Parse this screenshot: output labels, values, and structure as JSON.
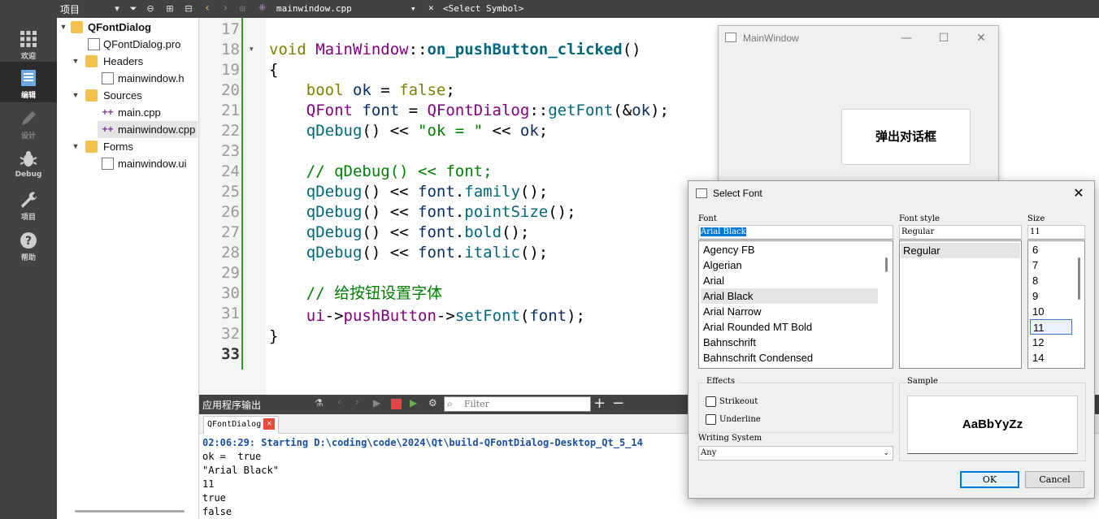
{
  "modebar": {
    "items": [
      {
        "label": "欢迎",
        "icon": "grid-icon"
      },
      {
        "label": "编辑",
        "icon": "document-icon"
      },
      {
        "label": "设计",
        "icon": "pencil-icon"
      },
      {
        "label": "Debug",
        "icon": "bug-icon"
      },
      {
        "label": "项目",
        "icon": "wrench-icon"
      },
      {
        "label": "帮助",
        "icon": "help-icon"
      }
    ]
  },
  "project": {
    "title": "项目",
    "tree": {
      "root": "QFontDialog",
      "pro": "QFontDialog.pro",
      "headers": "Headers",
      "header_file": "mainwindow.h",
      "sources": "Sources",
      "main_cpp": "main.cpp",
      "mainwindow_cpp": "mainwindow.cpp",
      "forms": "Forms",
      "ui_file": "mainwindow.ui"
    }
  },
  "editor": {
    "file": "mainwindow.cpp",
    "symbol": "<Select Symbol>",
    "line_numbers": [
      "17",
      "18",
      "19",
      "20",
      "21",
      "22",
      "23",
      "24",
      "25",
      "26",
      "27",
      "28",
      "29",
      "30",
      "31",
      "32",
      "33"
    ],
    "code": {
      "l18_kw": "void ",
      "l18_cls": "MainWindow",
      "l18_sep": "::",
      "l18_fn": "on_pushButton_clicked",
      "l18_paren": "()",
      "l19": "{",
      "l20_kw": "    bool ",
      "l20_var": "ok",
      "l20_eq": " = ",
      "l20_val": "false",
      "l20_end": ";",
      "l21_ty": "    QFont ",
      "l21_var": "font",
      "l21_eq": " = ",
      "l21_cls": "QFontDialog",
      "l21_sep": "::",
      "l21_fn": "getFont",
      "l21_args": "(&",
      "l21_arg": "ok",
      "l21_end": ");",
      "l22_fn": "    qDebug",
      "l22_a": "() << ",
      "l22_str": "\"ok = \"",
      "l22_b": " << ",
      "l22_var": "ok",
      "l22_end": ";",
      "l24": "    // qDebug() << font;",
      "l25_fn": "    qDebug",
      "l25_a": "() << ",
      "l25_var": "font",
      "l25_dot": ".",
      "l25_m": "family",
      "l25_end": "();",
      "l26_fn": "    qDebug",
      "l26_a": "() << ",
      "l26_var": "font",
      "l26_dot": ".",
      "l26_m": "pointSize",
      "l26_end": "();",
      "l27_fn": "    qDebug",
      "l27_a": "() << ",
      "l27_var": "font",
      "l27_dot": ".",
      "l27_m": "bold",
      "l27_end": "();",
      "l28_fn": "    qDebug",
      "l28_a": "() << ",
      "l28_var": "font",
      "l28_dot": ".",
      "l28_m": "italic",
      "l28_end": "();",
      "l30": "    // 给按钮设置字体",
      "l31_ui": "    ui",
      "l31_arrow": "->",
      "l31_pb": "pushButton",
      "l31_arrow2": "->",
      "l31_fn": "setFont",
      "l31_a": "(",
      "l31_var": "font",
      "l31_end": ");",
      "l32": "}"
    }
  },
  "output": {
    "title": "应用程序输出",
    "filter_placeholder": "Filter",
    "tab": "QFontDialog",
    "lines": [
      "02:06:29: Starting D:\\coding\\code\\2024\\Qt\\build-QFontDialog-Desktop_Qt_5_14",
      "ok =  true",
      "\"Arial Black\"",
      "11",
      "true",
      "false"
    ]
  },
  "mainwindow": {
    "title": "MainWindow",
    "button": "弹出对话框"
  },
  "fontdialog": {
    "title": "Select Font",
    "font_label": "Font",
    "font_value": "Arial Black",
    "style_label": "Font style",
    "style_value": "Regular",
    "size_label": "Size",
    "size_value": "11",
    "fonts": [
      "Agency FB",
      "Algerian",
      "Arial",
      "Arial Black",
      "Arial Narrow",
      "Arial Rounded MT Bold",
      "Bahnschrift",
      "Bahnschrift Condensed"
    ],
    "styles": [
      "Regular"
    ],
    "sizes": [
      "6",
      "7",
      "8",
      "9",
      "10",
      "11",
      "12",
      "14"
    ],
    "effects_label": "Effects",
    "strikeout": "Strikeout",
    "underline": "Underline",
    "sample_label": "Sample",
    "sample_text": "AaBbYyZz",
    "writing_system_label": "Writing System",
    "writing_system_value": "Any",
    "ok": "OK",
    "cancel": "Cancel"
  }
}
